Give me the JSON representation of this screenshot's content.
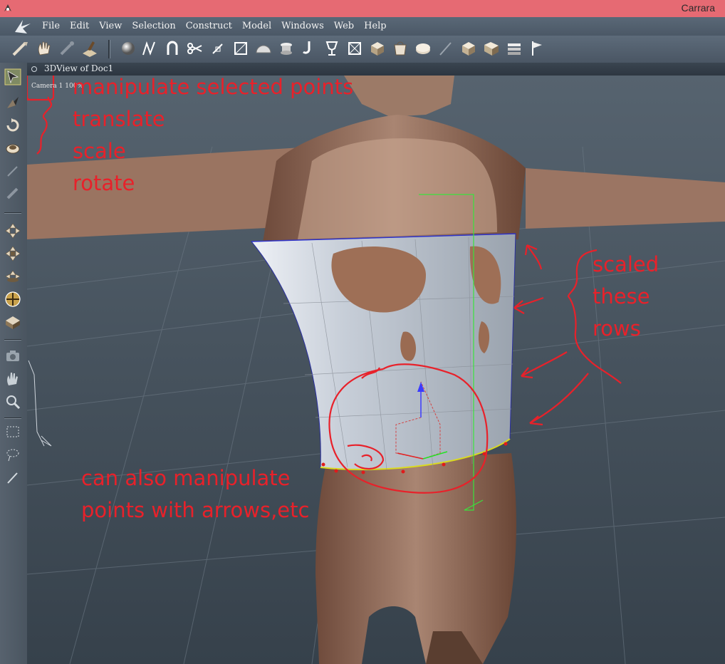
{
  "window": {
    "title": "Carrara"
  },
  "menu": [
    "File",
    "Edit",
    "View",
    "Selection",
    "Construct",
    "Model",
    "Windows",
    "Web",
    "Help"
  ],
  "toolbar_icons": [
    "move-tool-icon",
    "hand-tool-icon",
    "bone-tool-icon",
    "paint-tool-icon",
    "sphere-primitive-icon",
    "spline-icon",
    "magnet-icon",
    "scissors-icon",
    "pin-icon",
    "frame-icon",
    "hemisphere-icon",
    "lathe-icon",
    "hook-icon",
    "goblet-icon",
    "box-grid-icon",
    "cube-icon",
    "bag-icon",
    "disk-icon",
    "brush-icon",
    "cube-a-icon",
    "cube-b-icon",
    "cube-c-icon",
    "flag-icon"
  ],
  "left_tools": [
    "manipulate-selected-points-icon",
    "translate-icon",
    "rotate-icon",
    "scale-icon",
    "knife-icon",
    "link-icon",
    "move-xy-icon",
    "move-xz-icon",
    "move-yz-icon",
    "trackball-icon",
    "plane-icon",
    "camera-icon",
    "hand-pan-icon",
    "zoom-icon",
    "rect-select-icon",
    "lasso-icon",
    "paint-select-icon"
  ],
  "view": {
    "title": "3DView of Doc1",
    "camera": "Camera 1 100%"
  },
  "annotations": {
    "top_left": [
      "manipulate selected points",
      "translate",
      "scale",
      "rotate"
    ],
    "right": [
      "scaled",
      "these",
      "rows"
    ],
    "bottom": [
      "can also manipulate",
      "points with arrows,etc"
    ]
  },
  "colors": {
    "annotation": "#e8212a",
    "titlebar": "#e66a73",
    "skin": "#a87c66",
    "shirt": "#c4ccd6"
  }
}
